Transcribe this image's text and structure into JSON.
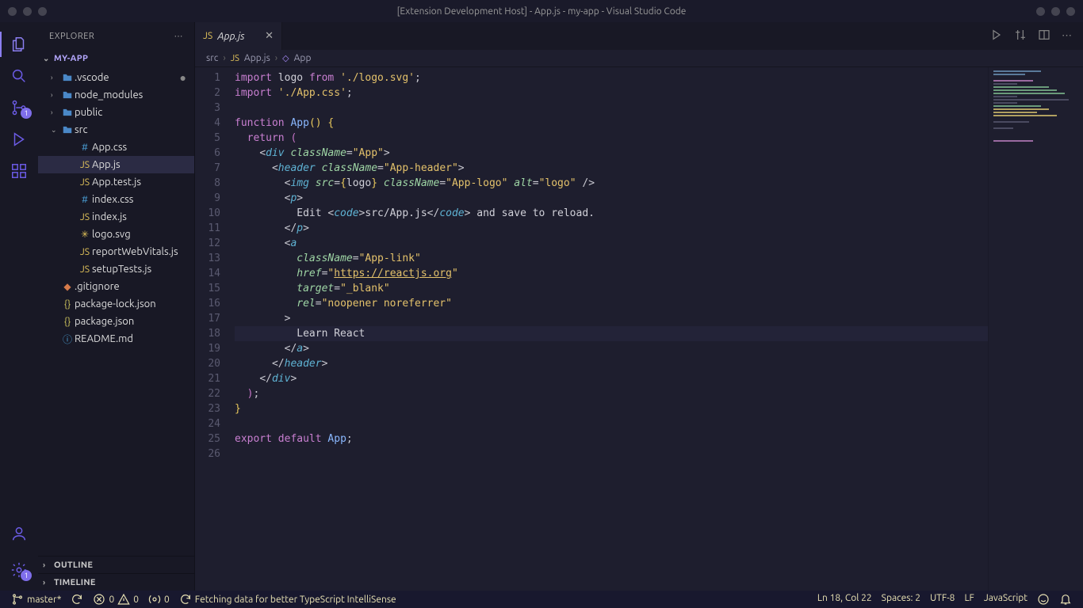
{
  "window": {
    "title": "[Extension Development Host] - App.js - my-app - Visual Studio Code"
  },
  "activity": {
    "badge_source_control": "1",
    "badge_settings": "1"
  },
  "sidebar": {
    "title": "EXPLORER",
    "project": "MY-APP",
    "outline": "OUTLINE",
    "timeline": "TIMELINE",
    "tree": [
      {
        "label": ".vscode",
        "kind": "folder",
        "depth": 1,
        "expanded": false,
        "dirty": true
      },
      {
        "label": "node_modules",
        "kind": "folder",
        "depth": 1,
        "expanded": false
      },
      {
        "label": "public",
        "kind": "folder",
        "depth": 1,
        "expanded": false
      },
      {
        "label": "src",
        "kind": "folder",
        "depth": 1,
        "expanded": true
      },
      {
        "label": "App.css",
        "kind": "css",
        "depth": 2
      },
      {
        "label": "App.js",
        "kind": "js",
        "depth": 2,
        "active": true
      },
      {
        "label": "App.test.js",
        "kind": "js",
        "depth": 2
      },
      {
        "label": "index.css",
        "kind": "css",
        "depth": 2
      },
      {
        "label": "index.js",
        "kind": "js",
        "depth": 2
      },
      {
        "label": "logo.svg",
        "kind": "svg",
        "depth": 2
      },
      {
        "label": "reportWebVitals.js",
        "kind": "js",
        "depth": 2
      },
      {
        "label": "setupTests.js",
        "kind": "js",
        "depth": 2
      },
      {
        "label": ".gitignore",
        "kind": "git",
        "depth": 1
      },
      {
        "label": "package-lock.json",
        "kind": "json",
        "depth": 1
      },
      {
        "label": "package.json",
        "kind": "json",
        "depth": 1
      },
      {
        "label": "README.md",
        "kind": "md",
        "depth": 1
      }
    ]
  },
  "tabs": {
    "items": [
      {
        "label": "App.js"
      }
    ]
  },
  "breadcrumbs": {
    "items": [
      "src",
      "App.js",
      "App"
    ]
  },
  "code": {
    "lines": [
      [
        {
          "t": "keyword",
          "v": "import"
        },
        {
          "t": "ident",
          "v": " logo "
        },
        {
          "t": "keyword",
          "v": "from"
        },
        {
          "t": "ident",
          "v": " "
        },
        {
          "t": "string",
          "v": "'./logo.svg'"
        },
        {
          "t": "punct",
          "v": ";"
        }
      ],
      [
        {
          "t": "keyword",
          "v": "import"
        },
        {
          "t": "ident",
          "v": " "
        },
        {
          "t": "string",
          "v": "'./App.css'"
        },
        {
          "t": "punct",
          "v": ";"
        }
      ],
      [],
      [
        {
          "t": "keyword",
          "v": "function"
        },
        {
          "t": "ident",
          "v": " "
        },
        {
          "t": "func",
          "v": "App"
        },
        {
          "t": "brace",
          "v": "()"
        },
        {
          "t": "ident",
          "v": " "
        },
        {
          "t": "brace",
          "v": "{"
        }
      ],
      [
        {
          "t": "ident",
          "v": "  "
        },
        {
          "t": "keyword-ret",
          "v": "return"
        },
        {
          "t": "ident",
          "v": " "
        },
        {
          "t": "paren",
          "v": "("
        }
      ],
      [
        {
          "t": "ident",
          "v": "    "
        },
        {
          "t": "punct",
          "v": "<"
        },
        {
          "t": "tag",
          "v": "div"
        },
        {
          "t": "ident",
          "v": " "
        },
        {
          "t": "attr",
          "v": "className"
        },
        {
          "t": "punct",
          "v": "="
        },
        {
          "t": "string",
          "v": "\"App\""
        },
        {
          "t": "punct",
          "v": ">"
        }
      ],
      [
        {
          "t": "ident",
          "v": "      "
        },
        {
          "t": "punct",
          "v": "<"
        },
        {
          "t": "tag",
          "v": "header"
        },
        {
          "t": "ident",
          "v": " "
        },
        {
          "t": "attr",
          "v": "className"
        },
        {
          "t": "punct",
          "v": "="
        },
        {
          "t": "string",
          "v": "\"App-header\""
        },
        {
          "t": "punct",
          "v": ">"
        }
      ],
      [
        {
          "t": "ident",
          "v": "        "
        },
        {
          "t": "punct",
          "v": "<"
        },
        {
          "t": "tag",
          "v": "img"
        },
        {
          "t": "ident",
          "v": " "
        },
        {
          "t": "attr",
          "v": "src"
        },
        {
          "t": "punct",
          "v": "="
        },
        {
          "t": "brace",
          "v": "{"
        },
        {
          "t": "ident",
          "v": "logo"
        },
        {
          "t": "brace",
          "v": "}"
        },
        {
          "t": "ident",
          "v": " "
        },
        {
          "t": "attr",
          "v": "className"
        },
        {
          "t": "punct",
          "v": "="
        },
        {
          "t": "string",
          "v": "\"App-logo\""
        },
        {
          "t": "ident",
          "v": " "
        },
        {
          "t": "attr",
          "v": "alt"
        },
        {
          "t": "punct",
          "v": "="
        },
        {
          "t": "string",
          "v": "\"logo\""
        },
        {
          "t": "ident",
          "v": " "
        },
        {
          "t": "punct",
          "v": "/>"
        }
      ],
      [
        {
          "t": "ident",
          "v": "        "
        },
        {
          "t": "punct",
          "v": "<"
        },
        {
          "t": "tag",
          "v": "p"
        },
        {
          "t": "punct",
          "v": ">"
        }
      ],
      [
        {
          "t": "ident",
          "v": "          Edit "
        },
        {
          "t": "punct",
          "v": "<"
        },
        {
          "t": "tag",
          "v": "code"
        },
        {
          "t": "punct",
          "v": ">"
        },
        {
          "t": "ident",
          "v": "src/App.js"
        },
        {
          "t": "punct",
          "v": "</"
        },
        {
          "t": "tag",
          "v": "code"
        },
        {
          "t": "punct",
          "v": ">"
        },
        {
          "t": "ident",
          "v": " and save to reload."
        }
      ],
      [
        {
          "t": "ident",
          "v": "        "
        },
        {
          "t": "punct",
          "v": "</"
        },
        {
          "t": "tag",
          "v": "p"
        },
        {
          "t": "punct",
          "v": ">"
        }
      ],
      [
        {
          "t": "ident",
          "v": "        "
        },
        {
          "t": "punct",
          "v": "<"
        },
        {
          "t": "tag",
          "v": "a"
        }
      ],
      [
        {
          "t": "ident",
          "v": "          "
        },
        {
          "t": "attr",
          "v": "className"
        },
        {
          "t": "punct",
          "v": "="
        },
        {
          "t": "string",
          "v": "\"App-link\""
        }
      ],
      [
        {
          "t": "ident",
          "v": "          "
        },
        {
          "t": "attr",
          "v": "href"
        },
        {
          "t": "punct",
          "v": "="
        },
        {
          "t": "string",
          "v": "\""
        },
        {
          "t": "url",
          "v": "https://reactjs.org"
        },
        {
          "t": "string",
          "v": "\""
        }
      ],
      [
        {
          "t": "ident",
          "v": "          "
        },
        {
          "t": "attr",
          "v": "target"
        },
        {
          "t": "punct",
          "v": "="
        },
        {
          "t": "string",
          "v": "\"_blank\""
        }
      ],
      [
        {
          "t": "ident",
          "v": "          "
        },
        {
          "t": "attr",
          "v": "rel"
        },
        {
          "t": "punct",
          "v": "="
        },
        {
          "t": "string",
          "v": "\"noopener noreferrer\""
        }
      ],
      [
        {
          "t": "ident",
          "v": "        "
        },
        {
          "t": "punct",
          "v": ">"
        }
      ],
      [
        {
          "t": "ident",
          "v": "          Learn React"
        }
      ],
      [
        {
          "t": "ident",
          "v": "        "
        },
        {
          "t": "punct",
          "v": "</"
        },
        {
          "t": "tag",
          "v": "a"
        },
        {
          "t": "punct",
          "v": ">"
        }
      ],
      [
        {
          "t": "ident",
          "v": "      "
        },
        {
          "t": "punct",
          "v": "</"
        },
        {
          "t": "tag",
          "v": "header"
        },
        {
          "t": "punct",
          "v": ">"
        }
      ],
      [
        {
          "t": "ident",
          "v": "    "
        },
        {
          "t": "punct",
          "v": "</"
        },
        {
          "t": "tag",
          "v": "div"
        },
        {
          "t": "punct",
          "v": ">"
        }
      ],
      [
        {
          "t": "ident",
          "v": "  "
        },
        {
          "t": "paren",
          "v": ")"
        },
        {
          "t": "punct",
          "v": ";"
        }
      ],
      [
        {
          "t": "brace",
          "v": "}"
        }
      ],
      [],
      [
        {
          "t": "keyword",
          "v": "export"
        },
        {
          "t": "ident",
          "v": " "
        },
        {
          "t": "keyword",
          "v": "default"
        },
        {
          "t": "ident",
          "v": " "
        },
        {
          "t": "func",
          "v": "App"
        },
        {
          "t": "punct",
          "v": ";"
        }
      ],
      []
    ],
    "highlight_line": 18
  },
  "status": {
    "branch": "master*",
    "sync": "",
    "errors": "0",
    "warnings": "0",
    "ports": "0",
    "fetching": "Fetching data for better TypeScript IntelliSense",
    "line_col": "Ln 18, Col 22",
    "spaces": "Spaces: 2",
    "encoding": "UTF-8",
    "eol": "LF",
    "language": "JavaScript"
  },
  "icons": {
    "folder": "📁",
    "js": "JS",
    "css": "#",
    "json": "{}",
    "svg": "✳",
    "git": "◆",
    "md": "ⓘ"
  }
}
